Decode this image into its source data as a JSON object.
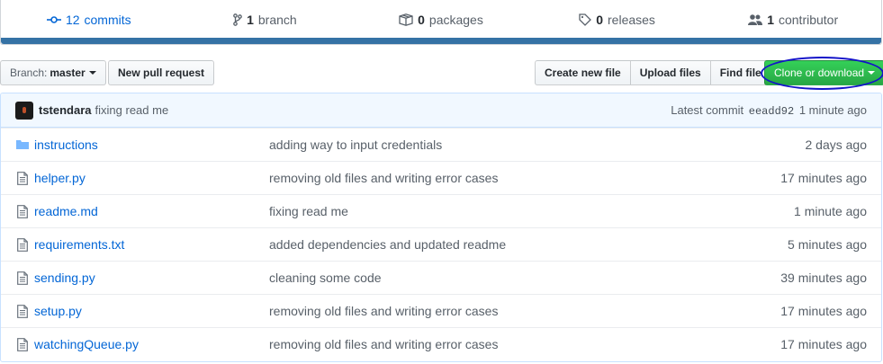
{
  "summary": {
    "commits": {
      "num": "12",
      "label": "commits"
    },
    "branches": {
      "num": "1",
      "label": "branch"
    },
    "packages": {
      "num": "0",
      "label": "packages"
    },
    "releases": {
      "num": "0",
      "label": "releases"
    },
    "contributors": {
      "num": "1",
      "label": "contributor"
    },
    "language_color": "#3572A5"
  },
  "toolbar": {
    "branch_prefix": "Branch:",
    "branch_name": "master",
    "new_pull_request": "New pull request",
    "create_new_file": "Create new file",
    "upload_files": "Upload files",
    "find_file": "Find file",
    "clone_or_download": "Clone or download"
  },
  "latest_commit": {
    "author": "tstendara",
    "message": "fixing read me",
    "label": "Latest commit",
    "sha": "eeadd92",
    "age": "1 minute ago"
  },
  "files": [
    {
      "type": "folder",
      "name": "instructions",
      "message": "adding way to input credentials",
      "age": "2 days ago"
    },
    {
      "type": "file",
      "name": "helper.py",
      "message": "removing old files and writing error cases",
      "age": "17 minutes ago"
    },
    {
      "type": "file",
      "name": "readme.md",
      "message": "fixing read me",
      "age": "1 minute ago"
    },
    {
      "type": "file",
      "name": "requirements.txt",
      "message": "added dependencies and updated readme",
      "age": "5 minutes ago"
    },
    {
      "type": "file",
      "name": "sending.py",
      "message": "cleaning some code",
      "age": "39 minutes ago"
    },
    {
      "type": "file",
      "name": "setup.py",
      "message": "removing old files and writing error cases",
      "age": "17 minutes ago"
    },
    {
      "type": "file",
      "name": "watchingQueue.py",
      "message": "removing old files and writing error cases",
      "age": "17 minutes ago"
    }
  ],
  "colors": {
    "link": "#0366d6",
    "green_button": "#28a745",
    "annotation": "#1414c8"
  }
}
